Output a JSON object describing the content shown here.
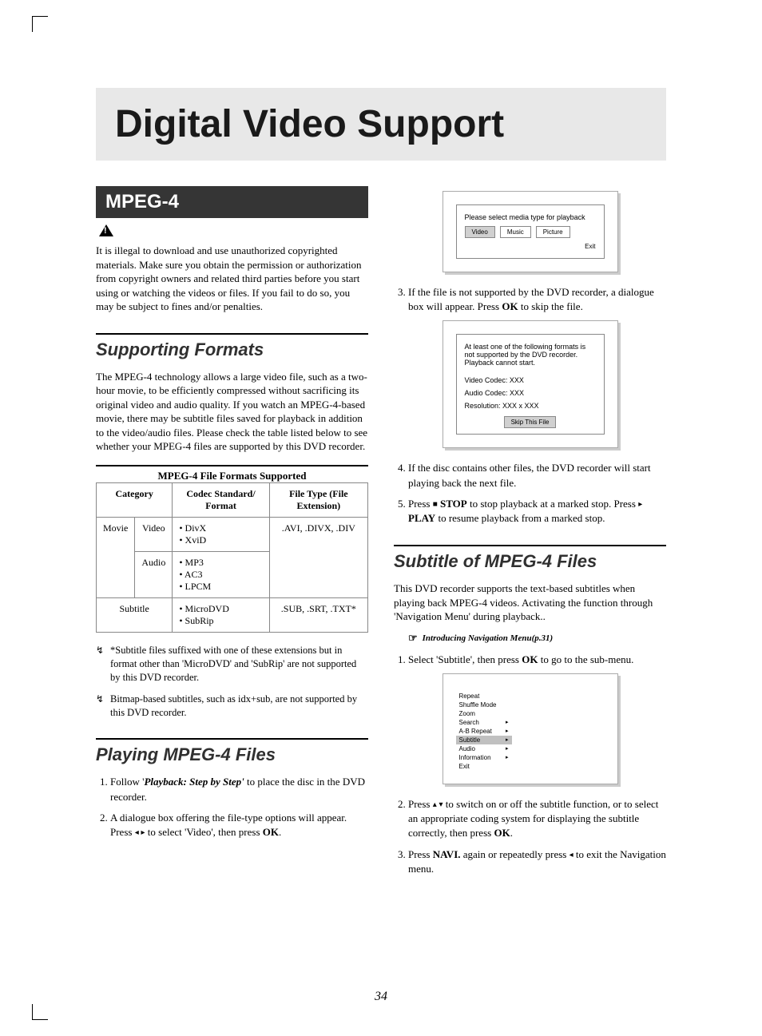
{
  "page_number": "34",
  "title": "Digital Video Support",
  "mpeg4": {
    "banner": "MPEG-4",
    "warning": "It is illegal to download and use unauthorized copyrighted materials. Make sure you obtain the permission or authorization from copyright owners and related third parties before you start using or watching the videos or files. If you fail to do so, you may be subject to fines and/or penalties."
  },
  "supporting": {
    "heading": "Supporting Formats",
    "intro": "The MPEG-4 technology allows a large video file, such as a two-hour movie, to be efficiently compressed without sacrificing its original video and audio quality. If you watch an MPEG-4-based movie, there may be subtitle files saved for playback in addition to the video/audio files. Please check the table listed below to see whether your MPEG-4 files are supported by this DVD recorder.",
    "table_title": "MPEG-4 File Formats Supported",
    "th": {
      "category": "Category",
      "codec": "Codec Standard/ Format",
      "filetype": "File Type (File Extension)"
    },
    "rows": {
      "movie": "Movie",
      "video": "Video",
      "audio": "Audio",
      "video_codec": "• DivX\n• XviD",
      "audio_codec": "• MP3\n• AC3\n• LPCM",
      "movie_ext": ".AVI, .DIVX, .DIV",
      "subtitle": "Subtitle",
      "subtitle_codec": "• MicroDVD\n• SubRip",
      "subtitle_ext": ".SUB, .SRT, .TXT*"
    },
    "notes": [
      "*Subtitle files suffixed with one of these extensions but in format other than 'MicroDVD' and 'SubRip' are not supported by this DVD recorder.",
      "Bitmap-based subtitles, such as idx+sub, are not supported by this DVD recorder."
    ]
  },
  "playing": {
    "heading": "Playing MPEG-4 Files",
    "steps": {
      "s1_a": "Follow '",
      "s1_b": "Playback: Step by Step'",
      "s1_c": " to place the disc in the DVD recorder.",
      "s2_a": "A dialogue box offering the file-type options will appear. Press ",
      "s2_b": " to select 'Video', then press ",
      "s2_c": "OK",
      "s2_d": "."
    }
  },
  "screen1": {
    "prompt": "Please select media type for playback",
    "video": "Video",
    "music": "Music",
    "picture": "Picture",
    "exit": "Exit"
  },
  "right_steps": {
    "s3_a": "If the file is not supported by the DVD recorder, a dialogue box will appear. Press ",
    "s3_b": "OK",
    "s3_c": " to skip the file.",
    "s4": "If the disc contains other files, the DVD recorder will start playing back the next file.",
    "s5_a": "Press ",
    "s5_stop": "STOP",
    "s5_b": " to stop playback at a marked stop. Press ",
    "s5_play": "PLAY",
    "s5_c": " to resume playback from a marked stop."
  },
  "screen2": {
    "line1": "At least one of the following formats is not supported by the DVD recorder. Playback cannot start.",
    "vc": "Video Codec: XXX",
    "ac": "Audio Codec: XXX",
    "res": "Resolution: XXX x XXX",
    "btn": "Skip This File"
  },
  "subtitle_section": {
    "heading": "Subtitle of MPEG-4 Files",
    "intro": "This DVD recorder supports the text-based subtitles when playing back MPEG-4 videos. Activating the function through 'Navigation Menu' during playback..",
    "ref": "Introducing Navigation Menu(p.31)",
    "s1_a": "Select 'Subtitle', then press ",
    "s1_b": "OK",
    "s1_c": " to go to the sub-menu.",
    "s2_a": "Press ",
    "s2_b": " to switch on or off the subtitle function, or to select an appropriate coding system for displaying the subtitle correctly, then press ",
    "s2_c": "OK",
    "s2_d": ".",
    "s3_a": "Press ",
    "s3_b": "NAVI.",
    "s3_c": " again or repeatedly press ",
    "s3_d": " to exit the Navigation menu."
  },
  "screen3": {
    "items": [
      "Repeat",
      "Shuffle Mode",
      "Zoom",
      "Search",
      "A-B Repeat",
      "Subtitle",
      "Audio",
      "Information",
      "Exit"
    ]
  }
}
